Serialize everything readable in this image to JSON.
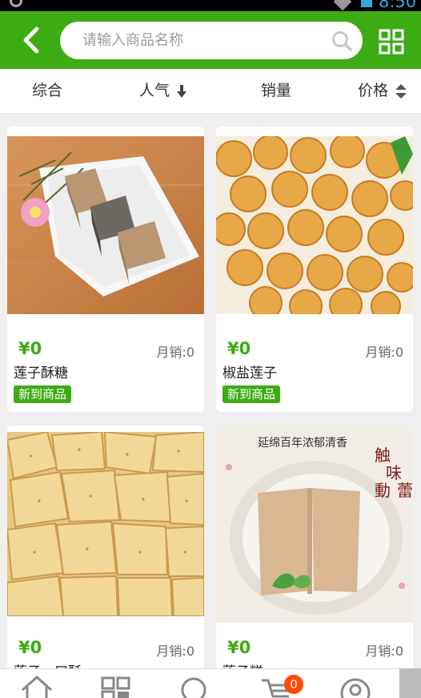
{
  "status_bar": {
    "time": "8:50"
  },
  "search": {
    "placeholder": "请输入商品名称"
  },
  "sort_tabs": [
    {
      "label": "综合"
    },
    {
      "label": "人气"
    },
    {
      "label": "销量"
    },
    {
      "label": "价格"
    }
  ],
  "products": [
    {
      "name": "莲子酥糖",
      "price": "¥0",
      "sales_label": "月销:",
      "sales": "0",
      "badge": "新到商品"
    },
    {
      "name": "椒盐莲子",
      "price": "¥0",
      "sales_label": "月销:",
      "sales": "0",
      "badge": "新到商品"
    },
    {
      "name": "莲子一口酥",
      "price": "¥0",
      "sales_label": "月销:",
      "sales": "0",
      "badge": ""
    },
    {
      "name": "莲子糕",
      "price": "¥0",
      "sales_label": "月销:",
      "sales": "0",
      "badge": "",
      "image_text": {
        "banner": "延绵百年浓郁清香",
        "c1": "触",
        "c2": "味",
        "c3": "蕾",
        "c4": "動"
      }
    }
  ],
  "bottom_nav": {
    "cart_count": "0"
  },
  "colors": {
    "brand_green": "#3cab14",
    "badge_orange": "#ff4a00"
  },
  "icons": [
    "back-icon",
    "search-icon",
    "grid-icon",
    "sort-down-arrow-icon",
    "sort-up-down-icon",
    "home-icon",
    "category-icon",
    "search-nav-icon",
    "cart-icon",
    "user-icon"
  ]
}
